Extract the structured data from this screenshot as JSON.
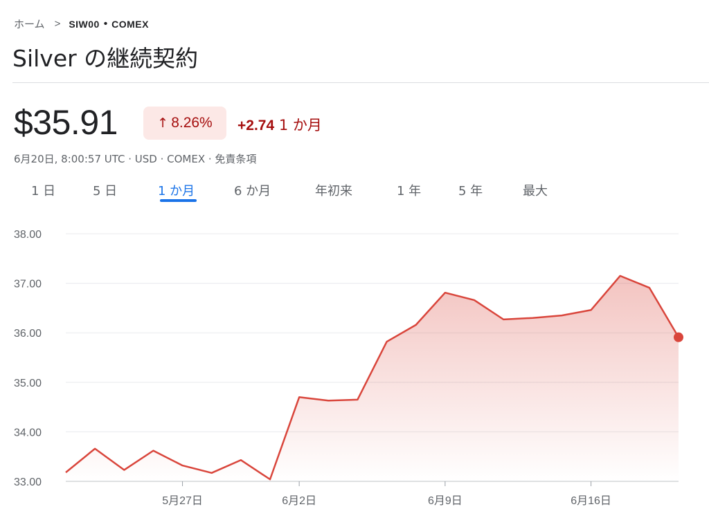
{
  "breadcrumb": {
    "home": "ホーム",
    "ticker": "SIW00",
    "separator": "•",
    "exchange": "COMEX"
  },
  "title": "Silver の継続契約",
  "quote": {
    "price": "$35.91",
    "percent_change": "8.26%",
    "abs_change": "+2.74",
    "period_label": "1 か月",
    "meta": "6月20日, 8:00:57 UTC · USD · COMEX · 免責条項"
  },
  "colors": {
    "accent": "#1a73e8",
    "negative_text": "#a50e0e",
    "badge_bg": "#fce8e6",
    "line": "#d9453b"
  },
  "tabs": [
    {
      "label": "1 日",
      "active": false
    },
    {
      "label": "5 日",
      "active": false
    },
    {
      "label": "1 か月",
      "active": true
    },
    {
      "label": "6 か月",
      "active": false
    },
    {
      "label": "年初来",
      "active": false
    },
    {
      "label": "1 年",
      "active": false
    },
    {
      "label": "5 年",
      "active": false
    },
    {
      "label": "最大",
      "active": false
    }
  ],
  "chart_data": {
    "type": "area",
    "title": "",
    "xlabel": "",
    "ylabel": "",
    "ylim": [
      33.0,
      38.0
    ],
    "yticks": [
      "33.00",
      "34.00",
      "35.00",
      "36.00",
      "37.00",
      "38.00"
    ],
    "x_tick_labels": [
      "5月27日",
      "6月2日",
      "6月9日",
      "6月16日"
    ],
    "grid": true,
    "series": [
      {
        "x": [
          "5月21日",
          "5月22日",
          "5月23日",
          "5月26日",
          "5月27日",
          "5月28日",
          "5月29日",
          "5月30日",
          "6月2日",
          "6月3日",
          "6月4日",
          "6月5日",
          "6月6日",
          "6月9日",
          "6月10日",
          "6月11日",
          "6月12日",
          "6月13日",
          "6月16日",
          "6月17日",
          "6月18日",
          "6月20日"
        ],
        "values": [
          33.18,
          33.66,
          33.23,
          33.62,
          33.32,
          33.17,
          33.43,
          33.04,
          34.7,
          34.63,
          34.65,
          35.82,
          36.16,
          36.81,
          36.66,
          36.27,
          36.3,
          36.35,
          36.46,
          37.15,
          36.91,
          35.91
        ]
      }
    ],
    "last_point_marker": true
  }
}
